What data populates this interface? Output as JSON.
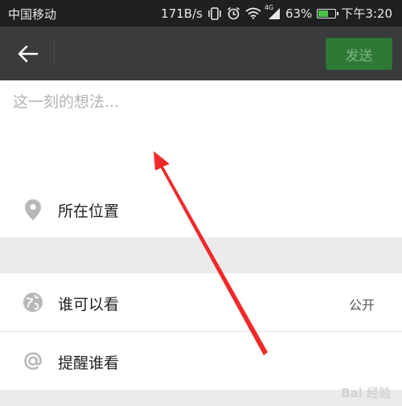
{
  "status_bar": {
    "carrier": "中国移动",
    "speed": "171B/s",
    "battery": "63%",
    "battery_level": 0.63,
    "time": "下午3:20",
    "network_label": "4G",
    "icons": [
      "vibrate-icon",
      "alarm-icon",
      "wifi-icon",
      "signal-icon",
      "battery-icon"
    ]
  },
  "header": {
    "back_icon": "back-arrow-icon",
    "send_label": "发送"
  },
  "compose": {
    "placeholder": "这一刻的想法..."
  },
  "location": {
    "icon": "location-pin-icon",
    "label": "所在位置"
  },
  "privacy": {
    "icon": "globe-icon",
    "label": "谁可以看",
    "value": "公开"
  },
  "mention": {
    "icon": "at-icon",
    "label": "提醒谁看"
  },
  "watermark": {
    "text": "Bai 经验"
  },
  "colors": {
    "status_bg": "#1f2022",
    "header_bg": "#3a3b3d",
    "send_bg": "#2e7a34",
    "annotation_arrow": "#f02a2a"
  }
}
